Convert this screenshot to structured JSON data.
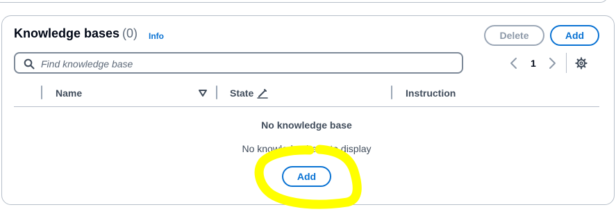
{
  "panel": {
    "title": "Knowledge bases",
    "count": "(0)",
    "info_label": "Info",
    "delete_label": "Delete",
    "add_label": "Add"
  },
  "search": {
    "placeholder": "Find knowledge base",
    "icon": "search-icon"
  },
  "pagination": {
    "current_page": "1",
    "prev_icon": "chevron-left-icon",
    "next_icon": "chevron-right-icon",
    "settings_icon": "gear-icon"
  },
  "table": {
    "columns": [
      {
        "label": "Name",
        "icon": "sort-descending-icon"
      },
      {
        "label": "State",
        "icon": "edit-icon"
      },
      {
        "label": "Instruction"
      }
    ],
    "empty": {
      "title": "No knowledge base",
      "description": "No knowledge base to display",
      "add_label": "Add"
    }
  },
  "colors": {
    "accent": "#0972d3",
    "border": "#b6bec9",
    "text": "#000716",
    "secondary_text": "#414d5c",
    "disabled": "#8d99a8",
    "annotation": "#ffff00"
  }
}
